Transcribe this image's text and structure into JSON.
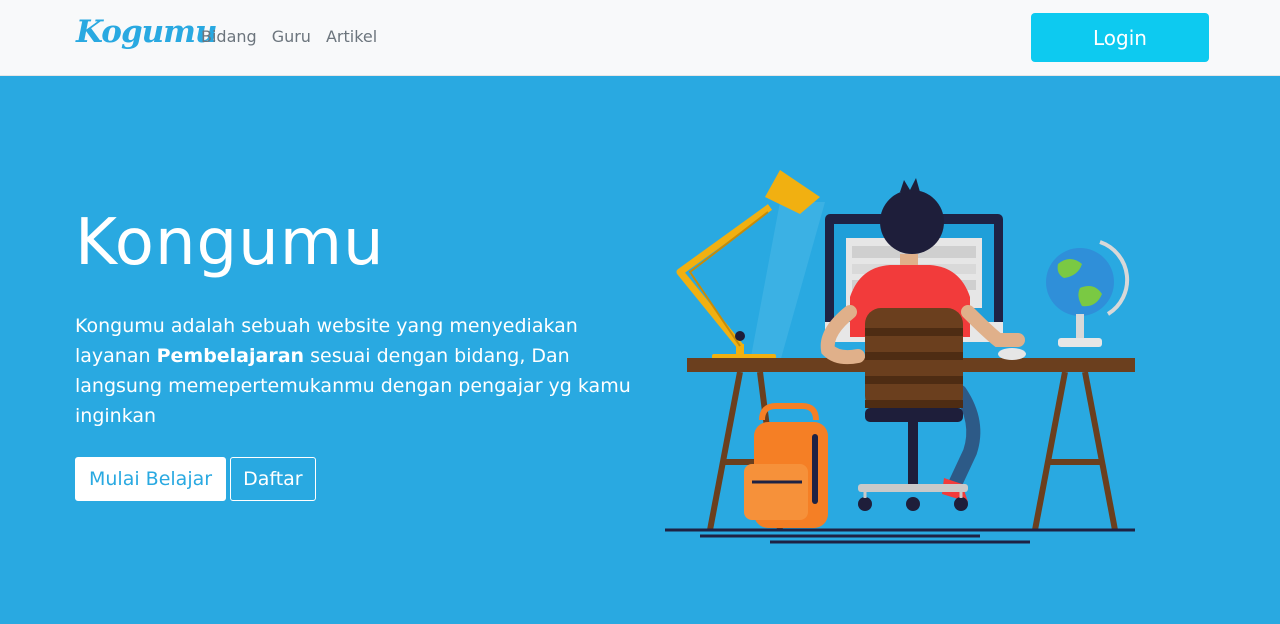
{
  "navbar": {
    "logo": "Kogumu",
    "links": [
      {
        "label": "Bidang"
      },
      {
        "label": "Guru"
      },
      {
        "label": "Artikel"
      }
    ],
    "login_label": "Login"
  },
  "hero": {
    "title": "Kongumu",
    "description_part1": "Kongumu adalah sebuah website yang menyediakan layanan ",
    "description_bold": "Pembelajaran",
    "description_part2": " sesuai dengan bidang, Dan langsung memepertemukanmu dengan pengajar yg kamu inginkan",
    "primary_button": "Mulai Belajar",
    "secondary_button": "Daftar"
  },
  "colors": {
    "hero_bg": "#29a9e1",
    "navbar_bg": "#f8f9fa",
    "login_button": "#0dcaf0",
    "shirt": "#f23b3b",
    "lamp": "#f1b011",
    "backpack": "#f57f25",
    "desk": "#6b3f1e"
  },
  "illustration": {
    "subject": "person-at-desk-illustration",
    "elements": [
      "desk-lamp-icon",
      "computer-monitor-icon",
      "globe-icon",
      "backpack-icon",
      "office-chair-icon"
    ]
  }
}
